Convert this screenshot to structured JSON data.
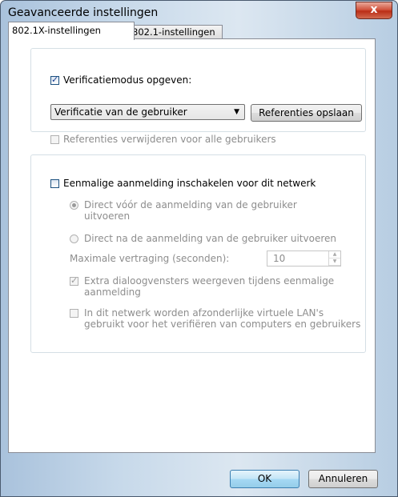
{
  "window": {
    "title": "Geavanceerde instellingen",
    "close_glyph": "x"
  },
  "tabs": [
    {
      "label": "802.1X-instellingen",
      "active": true
    },
    {
      "label": "802.1-instellingen",
      "active": false
    }
  ],
  "auth_group": {
    "checkbox_label": "Verificatiemodus opgeven:",
    "checked": true,
    "mode_select_value": "Verificatie van de gebruiker",
    "save_credentials_button": "Referenties opslaan",
    "delete_credentials_label": "Referenties verwijderen voor alle gebruikers",
    "delete_credentials_checked": false
  },
  "sso_group": {
    "checkbox_label": "Eenmalige aanmelding inschakelen voor dit netwerk",
    "checked": false,
    "radio_before_line1": "Direct vóór de aanmelding van de gebruiker",
    "radio_before_line2": "uitvoeren",
    "radio_after_label": "Direct na de aanmelding van de gebruiker uitvoeren",
    "max_delay_label": "Maximale vertraging (seconden):",
    "max_delay_value": "10",
    "extra_dialogs_line1": "Extra dialoogvensters weergeven tijdens eenmalige",
    "extra_dialogs_line2": "aanmelding",
    "extra_dialogs_checked": true,
    "vlan_line1": "In dit netwerk worden afzonderlijke virtuele LAN's",
    "vlan_line2": "gebruikt voor het verifiëren van computers en gebruikers",
    "vlan_checked": false
  },
  "footer": {
    "ok_label": "OK",
    "cancel_label": "Annuleren"
  }
}
